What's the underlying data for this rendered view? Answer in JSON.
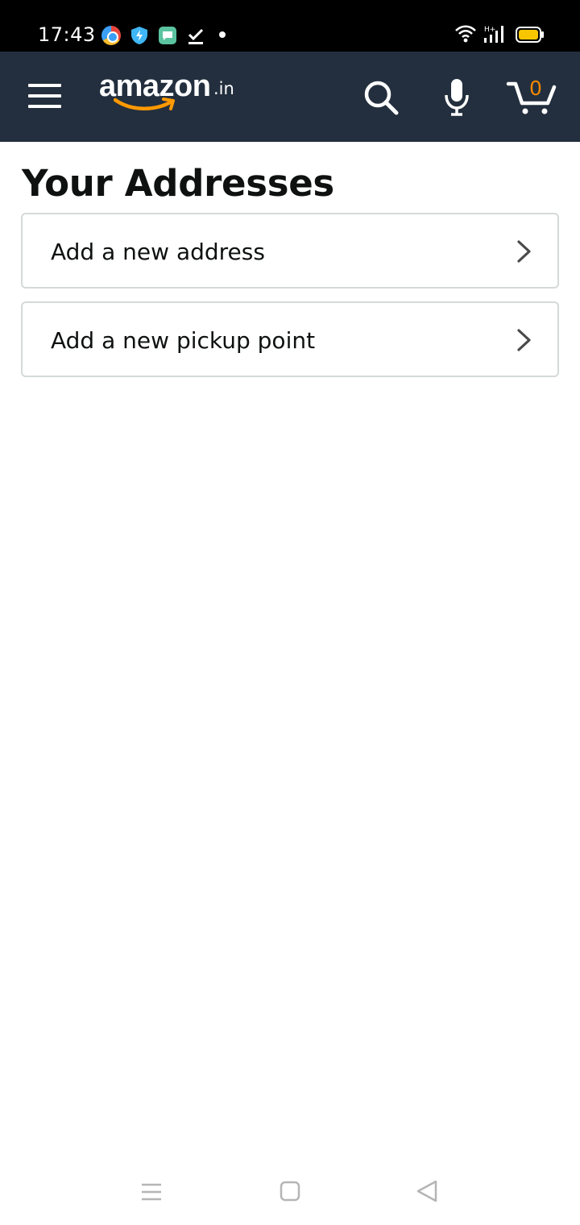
{
  "status_bar": {
    "time": "17:43",
    "notification_icons": [
      "chrome-icon",
      "shield-icon",
      "message-icon",
      "check-download-icon",
      "dot-icon"
    ],
    "system_icons": [
      "wifi-icon",
      "signal-hplus-icon",
      "battery-icon"
    ],
    "network_label": "H+"
  },
  "header": {
    "menu_icon": "hamburger-menu-icon",
    "logo_text": "amazon",
    "logo_tld": ".in",
    "search_icon": "search-icon",
    "mic_icon": "microphone-icon",
    "cart_icon": "cart-icon",
    "cart_count": "0",
    "colors": {
      "background": "#232f3e",
      "cart_count": "#f08804",
      "logo_smile": "#f90"
    }
  },
  "main": {
    "title": "Your Addresses",
    "options": [
      {
        "label": "Add a new address",
        "icon": "chevron-right-icon"
      },
      {
        "label": "Add a new pickup point",
        "icon": "chevron-right-icon"
      }
    ]
  },
  "nav_bar": {
    "buttons": [
      "recent-apps-icon",
      "home-icon",
      "back-icon"
    ]
  }
}
